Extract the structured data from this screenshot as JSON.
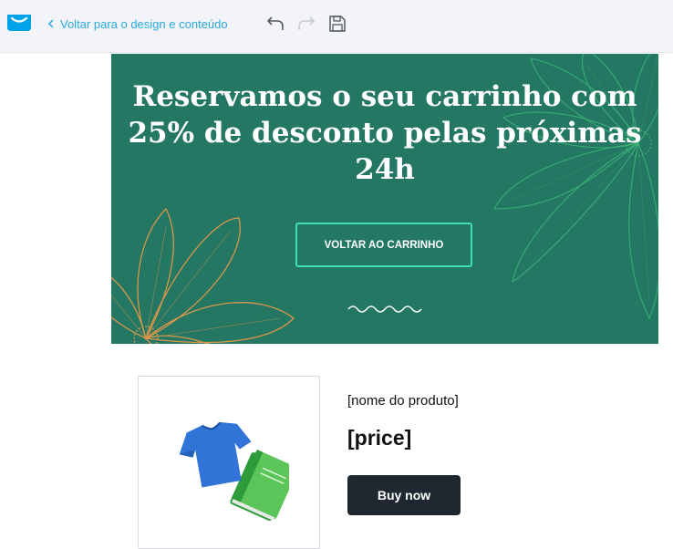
{
  "toolbar": {
    "back_label": "Voltar para o design e conteúdo",
    "icons": {
      "logo": "getresponse-logo-icon",
      "back": "chevron-left-icon",
      "undo": "undo-icon",
      "redo": "redo-icon",
      "save": "save-icon"
    },
    "redo_enabled": false
  },
  "hero": {
    "title": "Reservamos o seu carrinho com 25% de desconto pelas próximas 24h",
    "button_label": "VOLTAR AO CARRINHO",
    "colors": {
      "background": "#237763",
      "button_border": "#3fe0b4",
      "flower_left": "#d9964a",
      "flower_right": "#3fbf7a"
    }
  },
  "product": {
    "name": "[nome do produto]",
    "price": "[price]",
    "buy_label": "Buy now",
    "image_icon": "tshirt-and-book-icon"
  },
  "colors": {
    "accent": "#29a9e0",
    "dark_button": "#1f2830"
  }
}
